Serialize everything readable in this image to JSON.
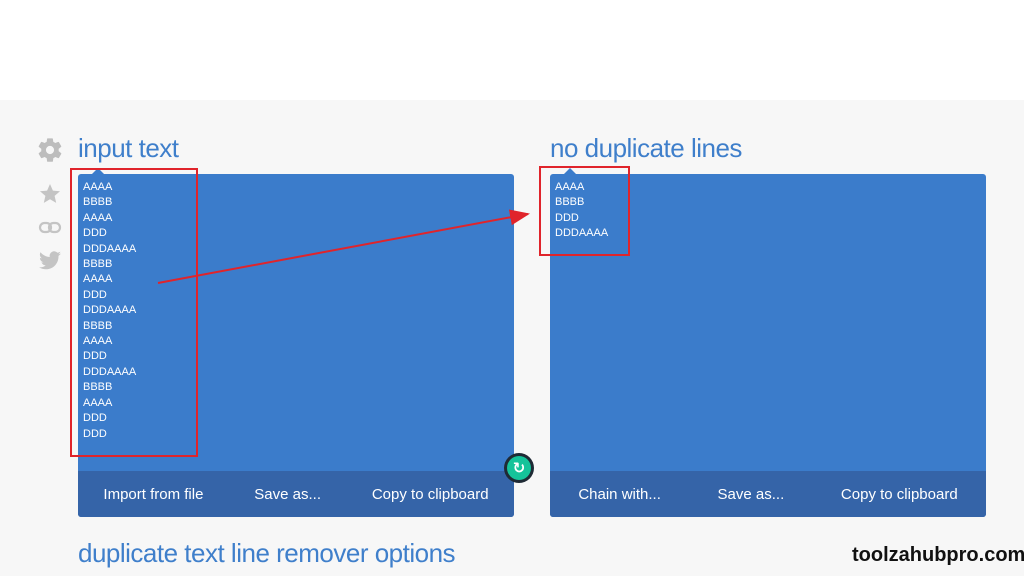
{
  "sidebar": {
    "icons": [
      "gear-icon",
      "star-icon",
      "link-icon",
      "twitter-icon"
    ]
  },
  "input_panel": {
    "title": "input text",
    "text": "AAAA\nBBBB\nAAAA\nDDD\nDDDAAAA\nBBBB\nAAAA\nDDD\nDDDAAAA\nBBBB\nAAAA\nDDD\nDDDAAAA\nBBBB\nAAAA\nDDD\nDDD",
    "buttons": {
      "import": "Import from file",
      "save": "Save as...",
      "copy": "Copy to clipboard"
    }
  },
  "output_panel": {
    "title": "no duplicate lines",
    "text": "AAAA\nBBBB\nDDD\nDDDAAAA",
    "buttons": {
      "chain": "Chain with...",
      "save": "Save as...",
      "copy": "Copy to clipboard"
    }
  },
  "options": {
    "title": "duplicate text line remover options"
  },
  "watermark": {
    "text": "toolzahubpro.com"
  },
  "colors": {
    "panel": "#3b7ccb",
    "toolbar": "#3564a8",
    "title": "#3f7fcb",
    "highlight": "#e0242b"
  }
}
